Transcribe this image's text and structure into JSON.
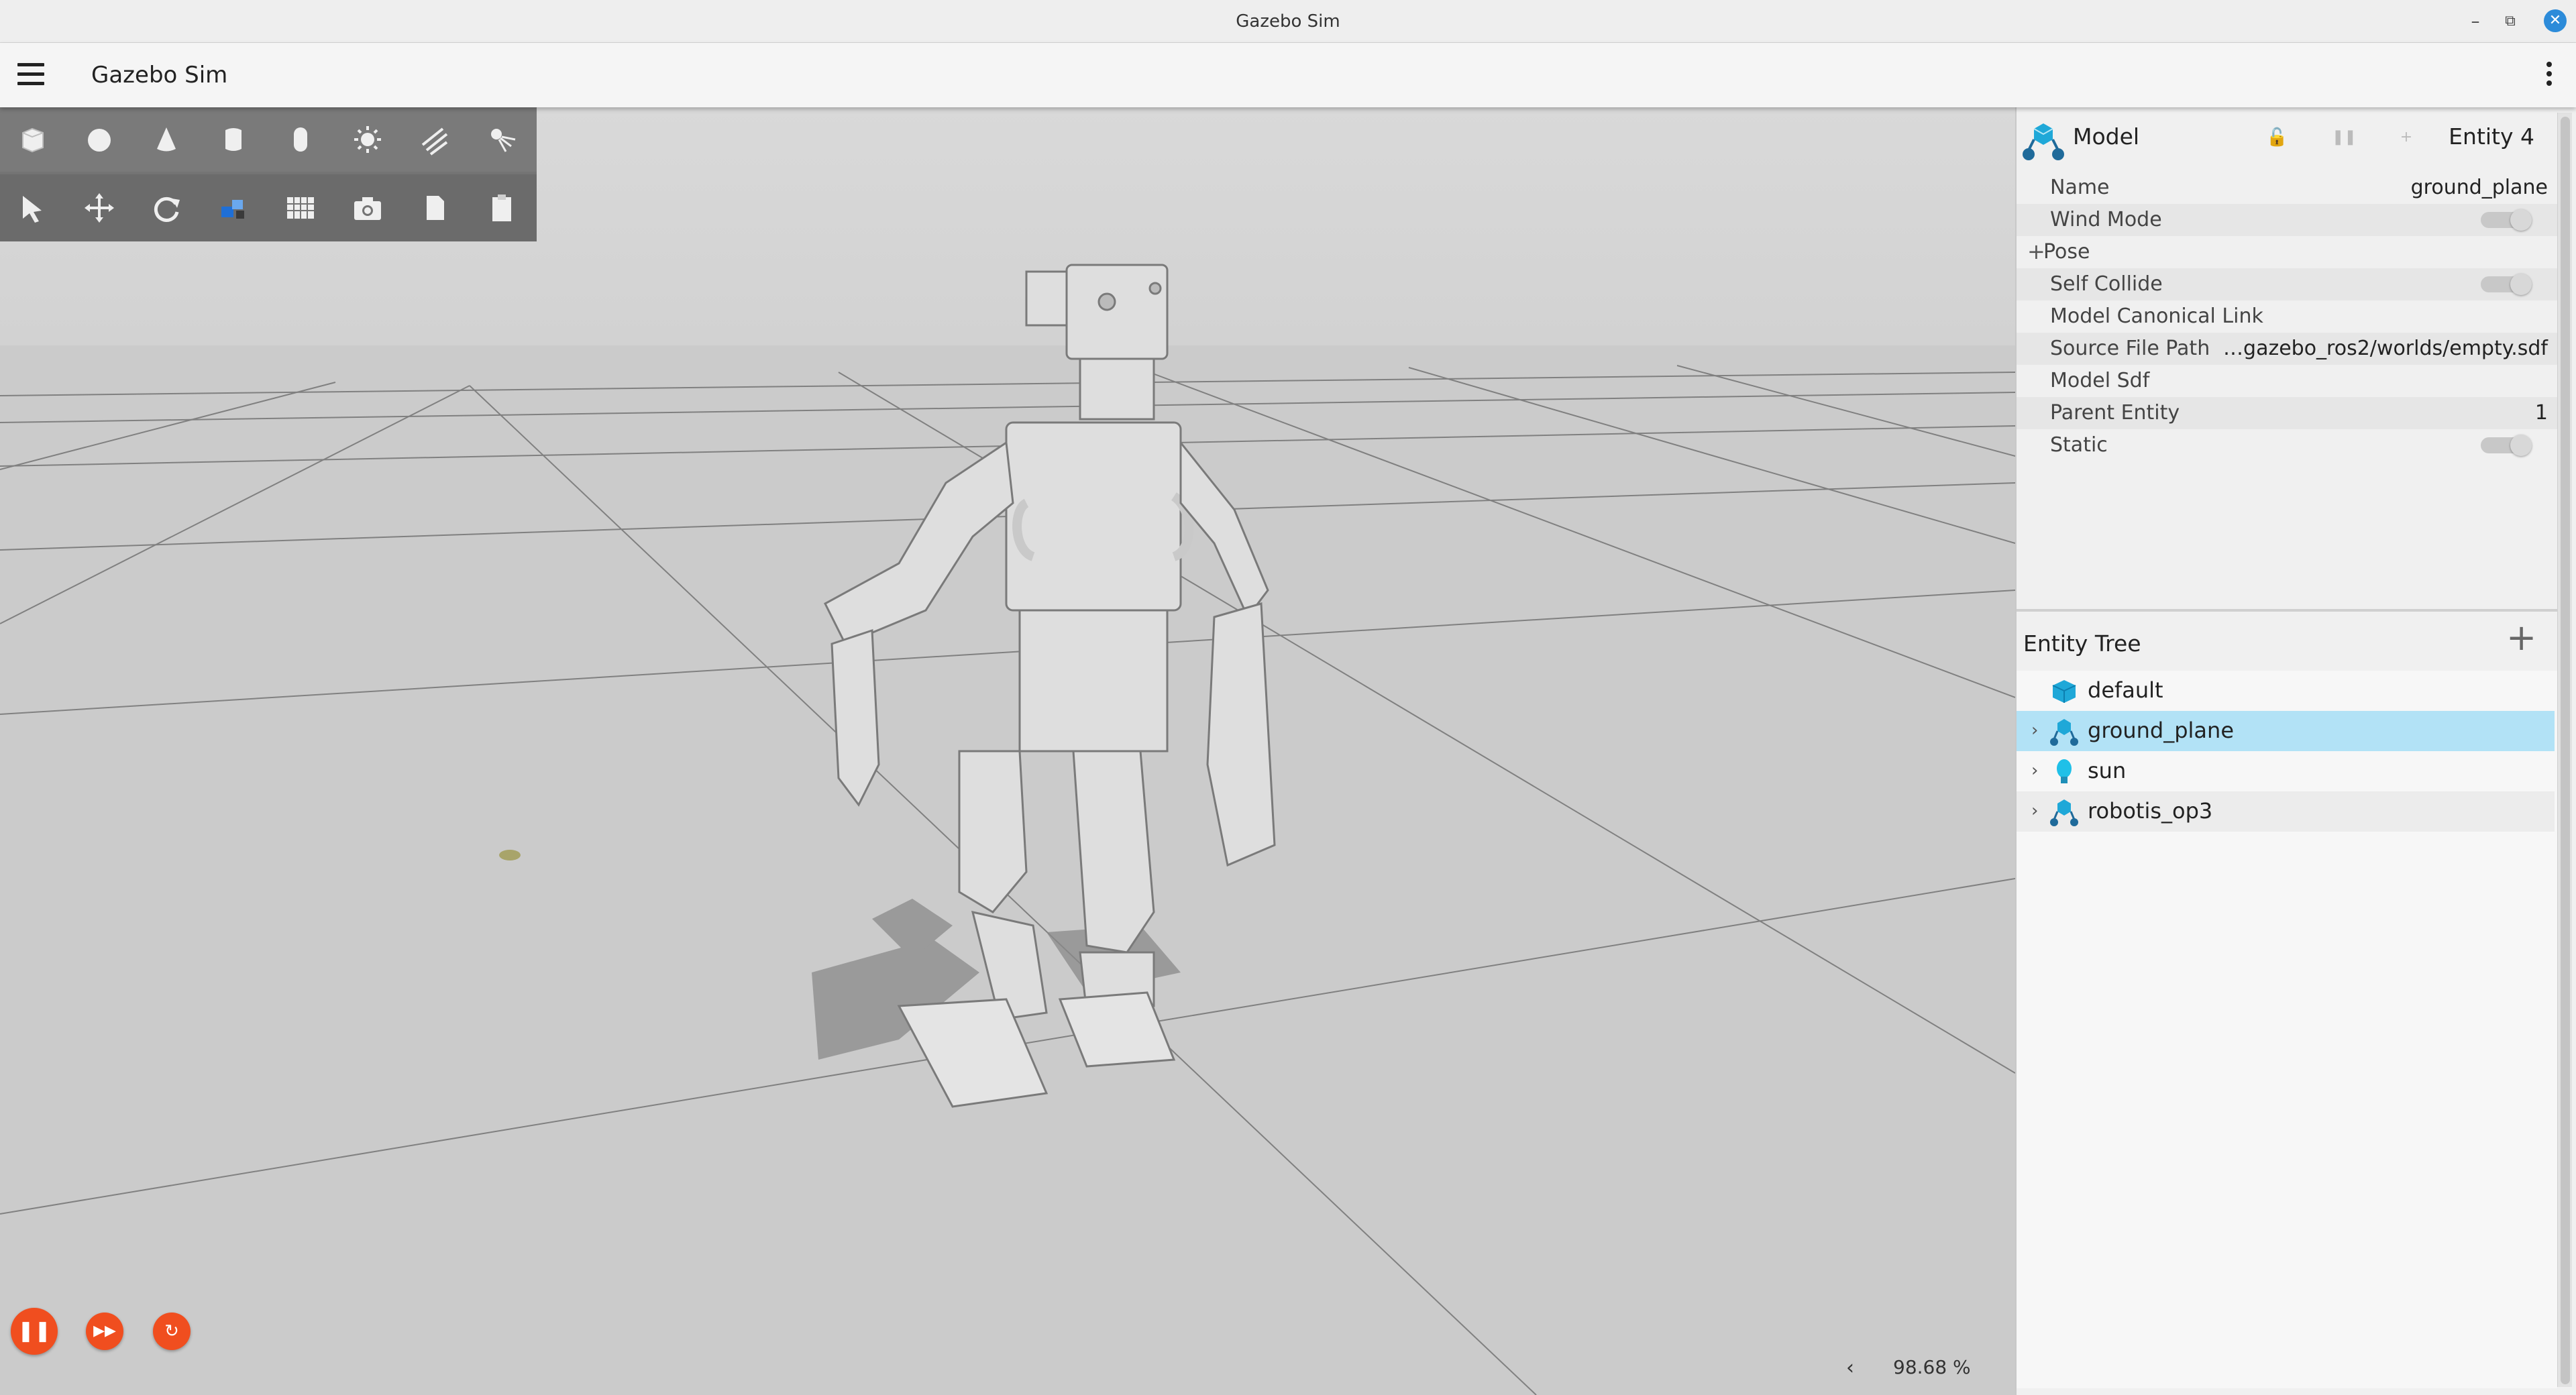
{
  "window": {
    "title": "Gazebo Sim",
    "minimize": "–",
    "maximize": "⧉",
    "close": "✕"
  },
  "appbar": {
    "title": "Gazebo Sim"
  },
  "toolbar": {
    "row1": [
      "box-icon",
      "sphere-icon",
      "cone-icon",
      "cylinder-icon",
      "capsule-icon",
      "sun-light-icon",
      "directional-light-icon",
      "spot-light-icon"
    ],
    "row2": [
      "select-icon",
      "translate-icon",
      "rotate-icon",
      "transform-control-icon",
      "grid-snap-icon",
      "camera-screenshot-icon",
      "copy-icon",
      "paste-icon"
    ]
  },
  "playback": {
    "pause": "❚❚",
    "step": "▶▶",
    "reset": "↻",
    "collapse_arrow": "‹",
    "real_time_factor": "98.68 %"
  },
  "component_inspector": {
    "type_label": "Model",
    "entity_label": "Entity 4",
    "properties": [
      {
        "key": "Name",
        "value": "ground_plane",
        "kind": "text"
      },
      {
        "key": "Wind Mode",
        "value": "",
        "kind": "toggle"
      },
      {
        "key": "Pose",
        "value": "",
        "kind": "expand"
      },
      {
        "key": "Self Collide",
        "value": "",
        "kind": "toggle"
      },
      {
        "key": "Model Canonical Link",
        "value": "",
        "kind": "text"
      },
      {
        "key": "Source File Path",
        "value": "…gazebo_ros2/worlds/empty.sdf",
        "kind": "text"
      },
      {
        "key": "Model Sdf",
        "value": "",
        "kind": "text"
      },
      {
        "key": "Parent Entity",
        "value": "1",
        "kind": "text"
      },
      {
        "key": "Static",
        "value": "",
        "kind": "toggle"
      }
    ],
    "pose_expand_symbol": "+"
  },
  "entity_tree": {
    "title": "Entity Tree",
    "add_symbol": "+",
    "items": [
      {
        "label": "default",
        "icon": "world-cube-icon",
        "expandable": false,
        "selected": false
      },
      {
        "label": "ground_plane",
        "icon": "model-icon",
        "expandable": true,
        "selected": true
      },
      {
        "label": "sun",
        "icon": "light-bulb-icon",
        "expandable": true,
        "selected": false
      },
      {
        "label": "robotis_op3",
        "icon": "model-icon",
        "expandable": true,
        "selected": false
      }
    ],
    "chevron": "›"
  },
  "colors": {
    "accent_orange": "#f04e1f",
    "selection_blue": "#b2e2f6",
    "model_icon_blue": "#1fa8d8",
    "viewport_gray": "#cccccc",
    "toolbar_gray": "#747474"
  }
}
